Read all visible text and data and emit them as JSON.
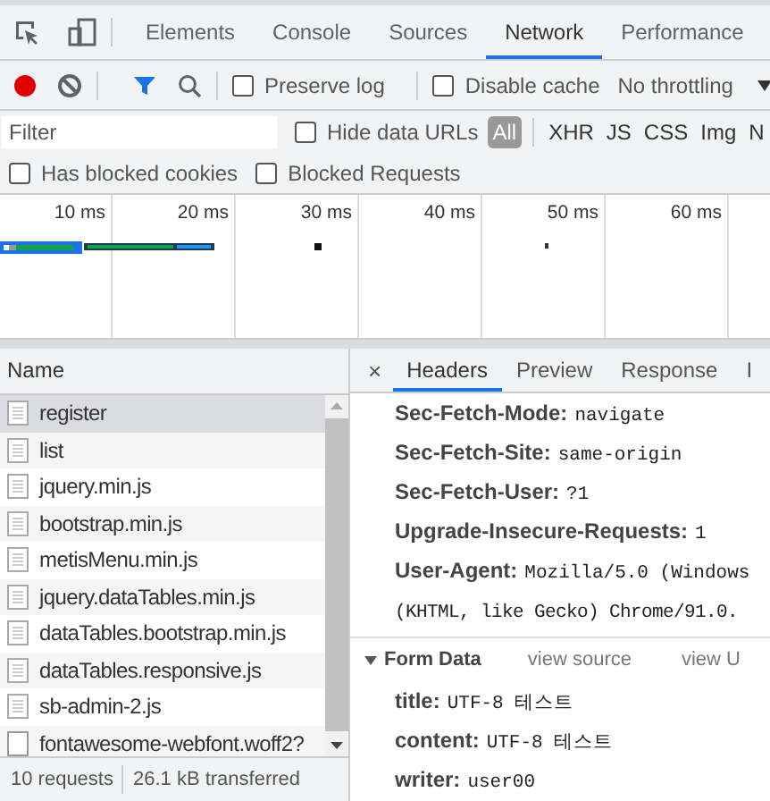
{
  "main_tabs": [
    {
      "label": "Elements",
      "selected": false
    },
    {
      "label": "Console",
      "selected": false
    },
    {
      "label": "Sources",
      "selected": false
    },
    {
      "label": "Network",
      "selected": true
    },
    {
      "label": "Performance",
      "selected": false
    }
  ],
  "toolbar": {
    "recording": true,
    "filter_active": true,
    "preserve_log": {
      "label": "Preserve log",
      "checked": false
    },
    "disable_cache": {
      "label": "Disable cache",
      "checked": false
    },
    "throttling": "No throttling"
  },
  "filter": {
    "placeholder": "Filter",
    "hide_data_urls": {
      "label": "Hide data URLs",
      "checked": false
    },
    "types": [
      {
        "label": "All",
        "selected": true
      },
      {
        "label": "XHR",
        "selected": false
      },
      {
        "label": "JS",
        "selected": false
      },
      {
        "label": "CSS",
        "selected": false
      },
      {
        "label": "Img",
        "selected": false
      },
      {
        "label": "N",
        "selected": false
      }
    ]
  },
  "blocked": [
    {
      "label": "Has blocked cookies",
      "checked": false
    },
    {
      "label": "Blocked Requests",
      "checked": false
    }
  ],
  "timeline": {
    "ticks": [
      "10 ms",
      "20 ms",
      "30 ms",
      "40 ms",
      "50 ms",
      "60 ms"
    ]
  },
  "requests": {
    "column": "Name",
    "rows": [
      {
        "name": "register",
        "kind": "document",
        "selected": true
      },
      {
        "name": "list",
        "kind": "document",
        "selected": false
      },
      {
        "name": "jquery.min.js",
        "kind": "document",
        "selected": false
      },
      {
        "name": "bootstrap.min.js",
        "kind": "document",
        "selected": false
      },
      {
        "name": "metisMenu.min.js",
        "kind": "document",
        "selected": false
      },
      {
        "name": "jquery.dataTables.min.js",
        "kind": "document",
        "selected": false
      },
      {
        "name": "dataTables.bootstrap.min.js",
        "kind": "document",
        "selected": false
      },
      {
        "name": "dataTables.responsive.js",
        "kind": "document",
        "selected": false
      },
      {
        "name": "sb-admin-2.js",
        "kind": "document",
        "selected": false
      },
      {
        "name": "fontawesome-webfont.woff2?",
        "kind": "blank",
        "selected": false
      }
    ]
  },
  "status_bar": [
    "10 requests",
    "26.1 kB transferred"
  ],
  "detail": {
    "close": "×",
    "tabs": [
      {
        "label": "Headers",
        "selected": true
      },
      {
        "label": "Preview",
        "selected": false
      },
      {
        "label": "Response",
        "selected": false
      },
      {
        "label": "I",
        "selected": false
      }
    ],
    "headers": [
      {
        "name": "Sec-Fetch-Mode:",
        "value_lines": [
          "navigate"
        ]
      },
      {
        "name": "Sec-Fetch-Site:",
        "value_lines": [
          "same-origin"
        ]
      },
      {
        "name": "Sec-Fetch-User:",
        "value_lines": [
          "?1"
        ]
      },
      {
        "name": "Upgrade-Insecure-Requests:",
        "value_lines": [
          "1"
        ]
      },
      {
        "name": "User-Agent:",
        "value_lines": [
          "Mozilla/5.0 (Windows",
          "(KHTML, like Gecko) Chrome/91.0."
        ]
      }
    ],
    "form_data": {
      "title": "Form Data",
      "expanded": true,
      "links": [
        "view source",
        "view U"
      ],
      "fields": [
        {
          "name": "title:",
          "value": "UTF-8 테스트"
        },
        {
          "name": "content:",
          "value": "UTF-8 테스트"
        },
        {
          "name": "writer:",
          "value": "user00"
        }
      ]
    }
  }
}
